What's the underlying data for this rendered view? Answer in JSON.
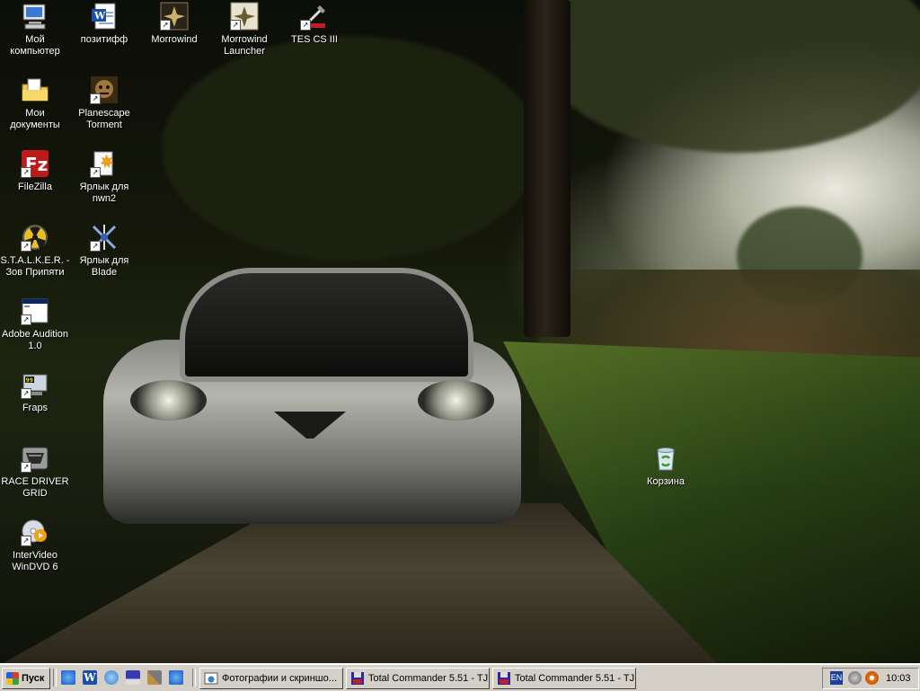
{
  "desktop_icons": [
    {
      "label": "Мой компьютер",
      "icon": "my-computer-icon"
    },
    {
      "label": "позитифф",
      "icon": "word-document-icon"
    },
    {
      "label": "Morrowind",
      "icon": "morrowind-icon"
    },
    {
      "label": "Morrowind Launcher",
      "icon": "morrowind-launcher-icon"
    },
    {
      "label": "TES CS III",
      "icon": "tes-construction-set-icon"
    },
    {
      "label": "Мои документы",
      "icon": "my-documents-icon"
    },
    {
      "label": "Planescape Torment",
      "icon": "planescape-torment-icon"
    },
    {
      "label": "FileZilla",
      "icon": "filezilla-icon"
    },
    {
      "label": "Ярлык для nwn2",
      "icon": "nwn2-shortcut-icon"
    },
    {
      "label": "S.T.A.L.K.E.R. - Зов Припяти",
      "icon": "stalker-radiation-icon"
    },
    {
      "label": "Ярлык для Blade",
      "icon": "blade-shortcut-icon"
    },
    {
      "label": "Adobe Audition 1.0",
      "icon": "application-window-icon"
    },
    {
      "label": "Fraps",
      "icon": "fraps-icon"
    },
    {
      "label": "RACE DRIVER GRID",
      "icon": "race-driver-grid-icon"
    },
    {
      "label": "InterVideo WinDVD 6",
      "icon": "windvd-disc-icon"
    },
    {
      "label": "Корзина",
      "icon": "recycle-bin-icon"
    }
  ],
  "taskbar": {
    "start_label": "Пуск",
    "quick_launch": [
      "internet-explorer-icon",
      "word-icon",
      "browser-icon",
      "save-disk-icon",
      "tools-icon",
      "internet-explorer-icon"
    ],
    "tasks": [
      {
        "label": "Фотографии и скриншо...",
        "icon": "browser-window-icon"
      },
      {
        "label": "Total Commander 5.51 - TJ",
        "icon": "total-commander-icon"
      },
      {
        "label": "Total Commander 5.51 - TJ",
        "icon": "total-commander-icon"
      }
    ],
    "tray": {
      "language": "EN",
      "clock": "10:03"
    }
  }
}
